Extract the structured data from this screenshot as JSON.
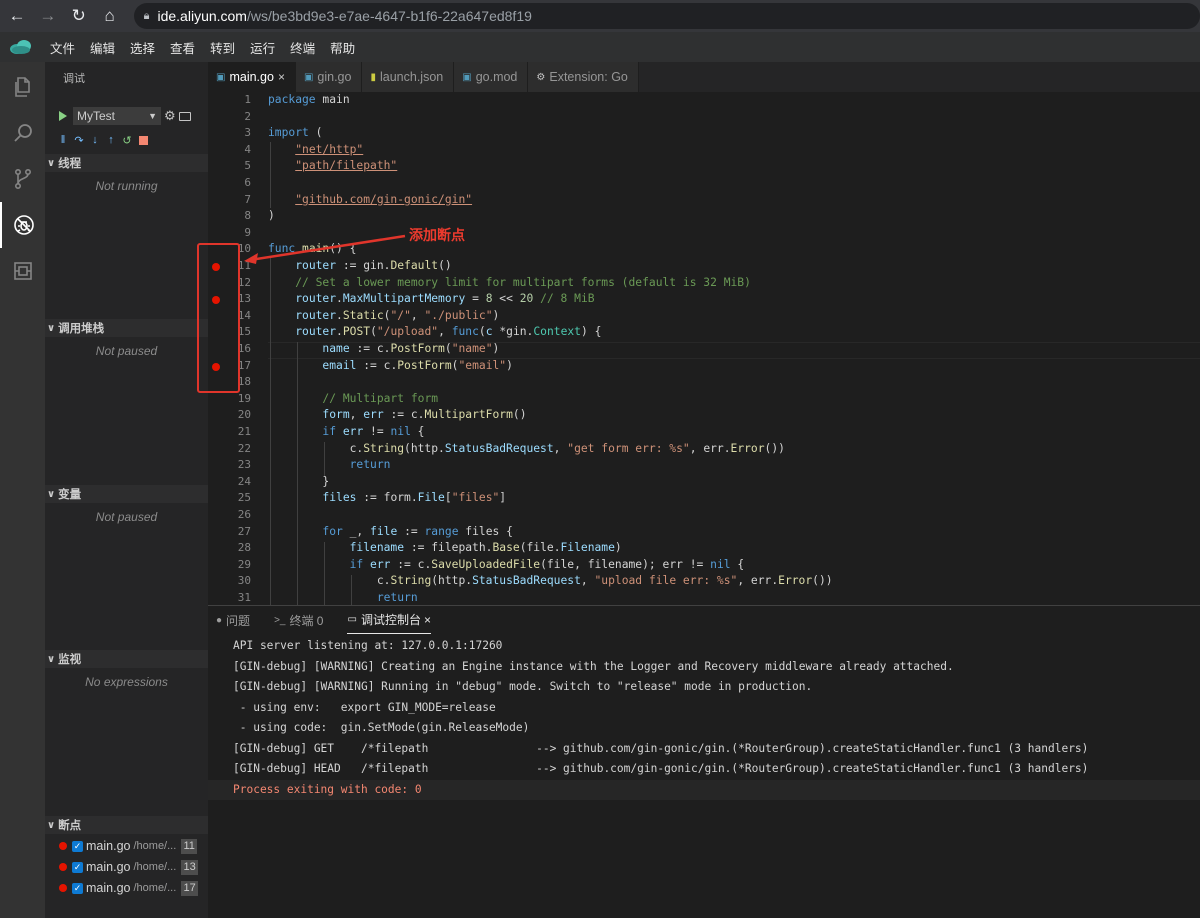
{
  "browser": {
    "url_host": "ide.aliyun.com",
    "url_path": "/ws/be3bd9e3-e7ae-4647-b1f6-22a647ed8f19"
  },
  "menu": [
    "文件",
    "编辑",
    "选择",
    "查看",
    "转到",
    "运行",
    "终端",
    "帮助"
  ],
  "activity_icons": [
    "files-icon",
    "search-icon",
    "source-control-icon",
    "debug-icon",
    "extensions-icon"
  ],
  "sidebar": {
    "title": "调试",
    "config_name": "MyTest",
    "sections": {
      "threads": {
        "label": "线程",
        "note": "Not running"
      },
      "callstack": {
        "label": "调用堆栈",
        "note": "Not paused"
      },
      "variables": {
        "label": "变量",
        "note": "Not paused"
      },
      "watch": {
        "label": "监视",
        "note": "No expressions"
      },
      "breakpoints": {
        "label": "断点"
      }
    },
    "breakpoints": [
      {
        "file": "main.go",
        "path": "/home/...",
        "line": "11"
      },
      {
        "file": "main.go",
        "path": "/home/...",
        "line": "13"
      },
      {
        "file": "main.go",
        "path": "/home/...",
        "line": "17"
      }
    ]
  },
  "tabs": [
    {
      "label": "main.go",
      "close": "×"
    },
    {
      "label": "gin.go"
    },
    {
      "label": "launch.json"
    },
    {
      "label": "go.mod"
    },
    {
      "label": "Extension: Go"
    }
  ],
  "editor": {
    "line_numbers": [
      "1",
      "2",
      "3",
      "4",
      "5",
      "6",
      "7",
      "8",
      "9",
      "10",
      "11",
      "12",
      "13",
      "14",
      "15",
      "16",
      "17",
      "18",
      "19",
      "20",
      "21",
      "22",
      "23",
      "24",
      "25",
      "26",
      "27",
      "28",
      "29",
      "30",
      "31"
    ],
    "breakpoint_lines": [
      11,
      13,
      17
    ],
    "annotation": "添加断点"
  },
  "panel": {
    "tabs": [
      "问题",
      "终端 0",
      "调试控制台"
    ],
    "close": "×",
    "console": [
      "API server listening at: 127.0.0.1:17260",
      "[GIN-debug] [WARNING] Creating an Engine instance with the Logger and Recovery middleware already attached.",
      "[GIN-debug] [WARNING] Running in \"debug\" mode. Switch to \"release\" mode in production.",
      " - using env:   export GIN_MODE=release",
      " - using code:  gin.SetMode(gin.ReleaseMode)",
      "[GIN-debug] GET    /*filepath                --> github.com/gin-gonic/gin.(*RouterGroup).createStaticHandler.func1 (3 handlers)",
      "[GIN-debug] HEAD   /*filepath                --> github.com/gin-gonic/gin.(*RouterGroup).createStaticHandler.func1 (3 handlers)",
      "Process exiting with code: 0"
    ]
  }
}
